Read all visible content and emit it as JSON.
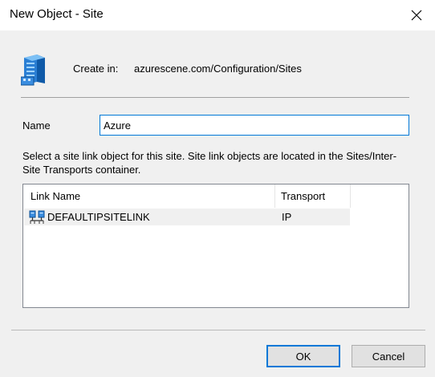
{
  "window": {
    "title": "New Object - Site",
    "close_icon": "close-icon"
  },
  "create_in": {
    "label": "Create in:",
    "path": "azurescene.com/Configuration/Sites",
    "icon": "site-object-icon"
  },
  "form": {
    "name_label": "Name",
    "name_value": "Azure",
    "description": "Select a site link object for this site. Site link objects are located in the Sites/Inter-Site Transports container."
  },
  "site_links": {
    "columns": {
      "name": "Link Name",
      "transport": "Transport"
    },
    "rows": [
      {
        "name": "DEFAULTIPSITELINK",
        "transport": "IP",
        "icon": "site-link-icon"
      }
    ]
  },
  "buttons": {
    "ok": "OK",
    "cancel": "Cancel"
  },
  "colors": {
    "accent": "#0078d7",
    "dialog_bg": "#f0f0f0",
    "titlebar_bg": "#ffffff"
  }
}
